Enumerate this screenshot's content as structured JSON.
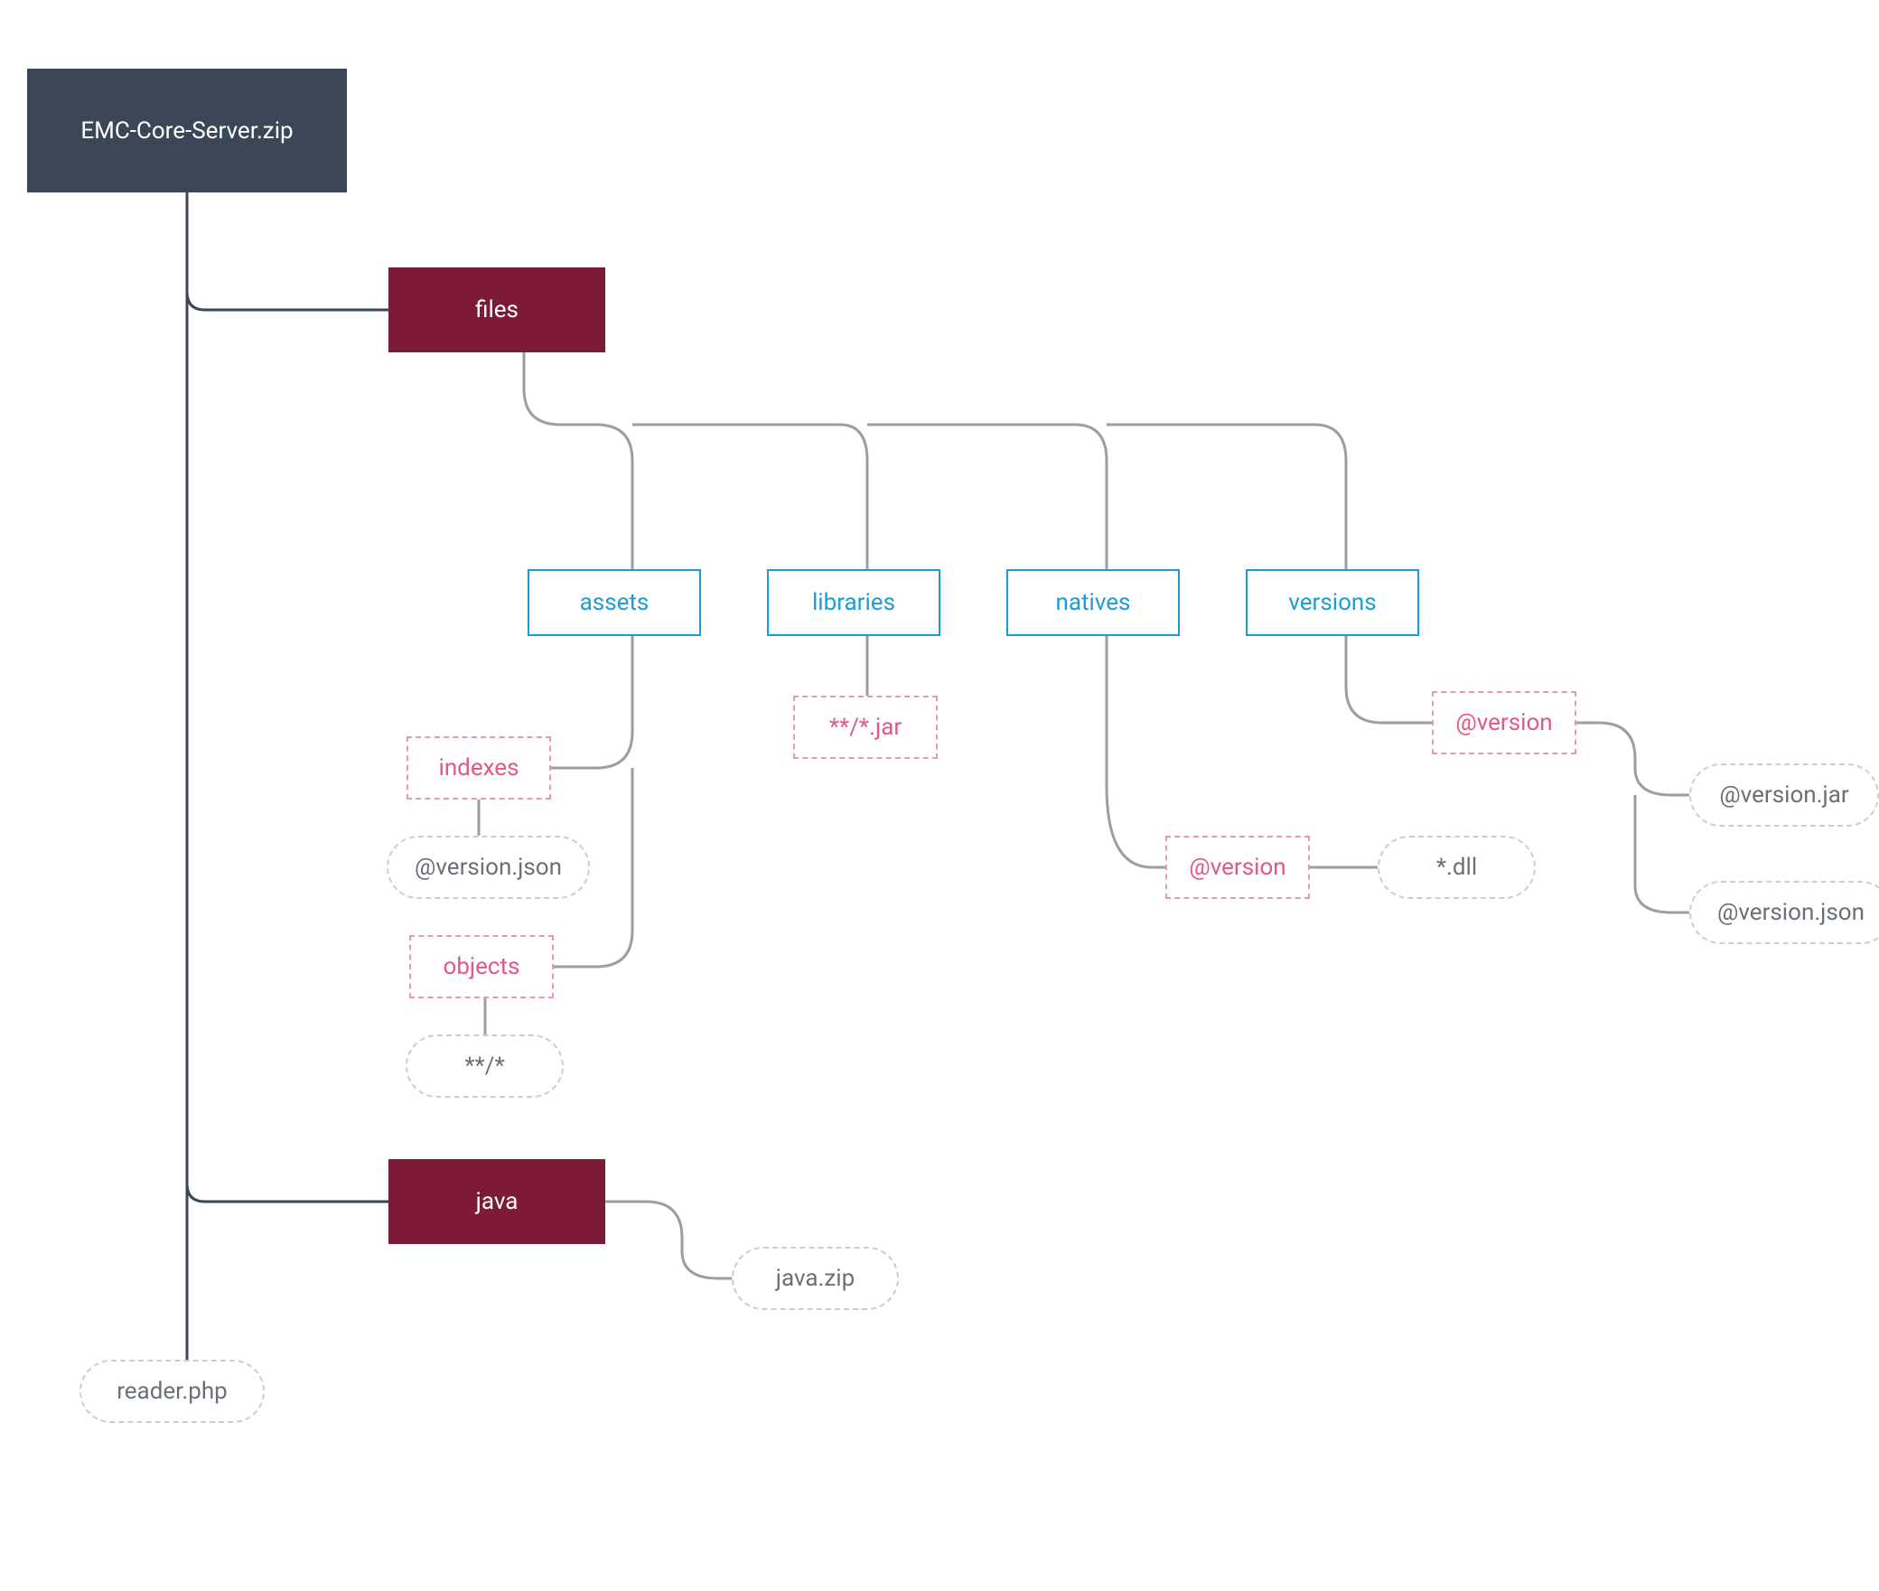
{
  "root": "EMC-Core-Server.zip",
  "level1": {
    "files": "files",
    "java": "java",
    "reader": "reader.php"
  },
  "files_children": {
    "assets": "assets",
    "libraries": "libraries",
    "natives": "natives",
    "versions": "versions"
  },
  "assets_children": {
    "indexes": "indexes",
    "indexes_file": "@version.json",
    "objects": "objects",
    "objects_file": "**/*"
  },
  "libraries_file": "**/*.jar",
  "natives_children": {
    "version": "@version",
    "dll": "*.dll"
  },
  "versions_children": {
    "version": "@version",
    "jar": "@version.jar",
    "json": "@version.json"
  },
  "java_file": "java.zip"
}
